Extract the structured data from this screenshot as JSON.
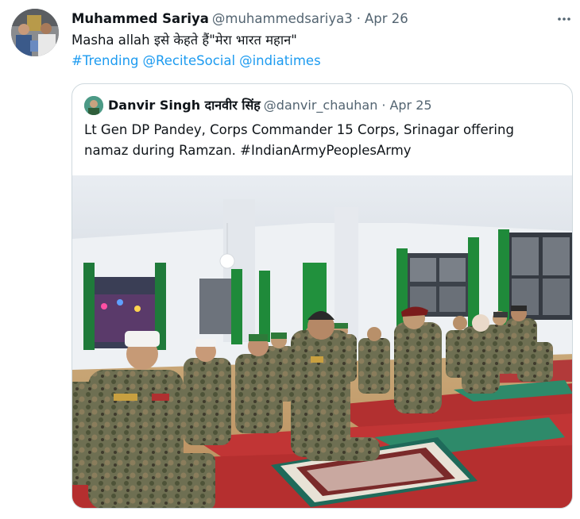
{
  "tweet": {
    "author_name": "Muhammed Sariya",
    "author_handle": "@muhammedsariya3",
    "separator": "·",
    "time": "Apr 26",
    "more_icon": "more-dots-icon",
    "text": "Masha allah इसे केहते हैं\"मेरा भारत महान\"",
    "tags": [
      "#Trending",
      "@ReciteSocial",
      "@indiatimes"
    ]
  },
  "quote": {
    "author_name": "Danvir Singh दानवीर सिंह",
    "author_handle": "@danvir_chauhan",
    "separator": "·",
    "time": "Apr 25",
    "text": "Lt Gen DP Pandey, Corps Commander 15 Corps, Srinagar offering namaz during Ramzan. #IndianArmyPeoplesArmy"
  },
  "colors": {
    "link": "#1d9bf0",
    "secondary_text": "#536471",
    "border": "#cfd9de"
  }
}
